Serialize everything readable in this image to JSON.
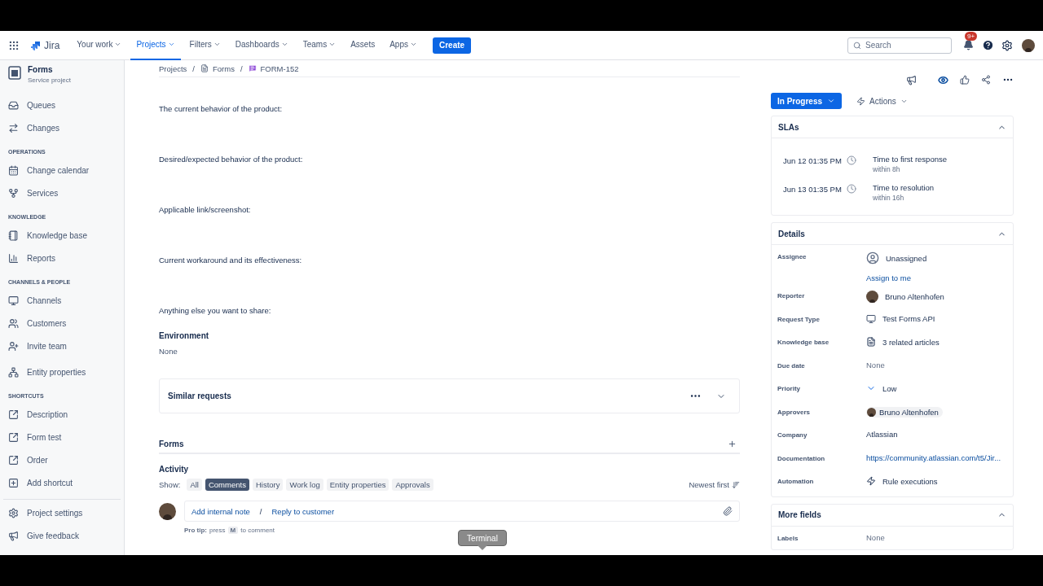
{
  "nav": {
    "product": "Jira",
    "items": [
      {
        "label": "Your work",
        "selected": false,
        "dropdown": true
      },
      {
        "label": "Projects",
        "selected": true,
        "dropdown": true
      },
      {
        "label": "Filters",
        "selected": false,
        "dropdown": true
      },
      {
        "label": "Dashboards",
        "selected": false,
        "dropdown": true
      },
      {
        "label": "Teams",
        "selected": false,
        "dropdown": true
      },
      {
        "label": "Assets",
        "selected": false,
        "dropdown": false
      },
      {
        "label": "Apps",
        "selected": false,
        "dropdown": true
      }
    ],
    "create": "Create",
    "search": {
      "placeholder": "Search"
    },
    "notifications": "9+"
  },
  "sidebar": {
    "project": {
      "name": "Forms",
      "type": "Service project"
    },
    "groups": [
      {
        "items": [
          "Queues",
          "Changes"
        ]
      },
      {
        "heading": "OPERATIONS",
        "items": [
          "Change calendar",
          "Services"
        ]
      },
      {
        "heading": "KNOWLEDGE",
        "items": [
          "Knowledge base",
          "Reports"
        ]
      },
      {
        "heading": "CHANNELS & PEOPLE",
        "items": [
          "Channels",
          "Customers",
          "Invite team"
        ]
      },
      {
        "items": [
          "Entity properties"
        ]
      },
      {
        "heading": "SHORTCUTS",
        "items": [
          "Description",
          "Form test",
          "Order",
          "Add shortcut"
        ]
      }
    ],
    "footer": [
      "Project settings",
      "Give feedback"
    ]
  },
  "breadcrumbs": [
    {
      "label": "Projects"
    },
    {
      "separator": "/",
      "label": "Forms"
    },
    {
      "separator": "/",
      "label": "FORM-152"
    }
  ],
  "description": [
    "The current behavior of the product:",
    "Desired/expected behavior of the product:",
    "Applicable link/screenshot:",
    "Current workaround and its effectiveness:",
    "Anything else you want to share:"
  ],
  "environment": {
    "label": "Environment",
    "value": "None"
  },
  "similar_requests": {
    "title": "Similar requests"
  },
  "forms": {
    "title": "Forms"
  },
  "activity": {
    "title": "Activity",
    "show_label": "Show:",
    "filters": [
      {
        "label": "All",
        "selected": false
      },
      {
        "label": "Comments",
        "selected": true
      },
      {
        "label": "History",
        "selected": false
      },
      {
        "label": "Work log",
        "selected": false
      },
      {
        "label": "Entity properties",
        "selected": false
      },
      {
        "label": "Approvals",
        "selected": false
      }
    ],
    "sort": "Newest first",
    "add_note": "Add internal note",
    "separator": "/",
    "reply": "Reply to customer",
    "pro_tip": {
      "label": "Pro tip:",
      "before": "press",
      "key": "M",
      "after": "to comment"
    }
  },
  "status": {
    "label": "In Progress"
  },
  "actions": "Actions",
  "slas": {
    "title": "SLAs",
    "expanded": true,
    "items": [
      {
        "date": "Jun 12 01:35 PM",
        "name": "Time to first response",
        "limit": "within 8h"
      },
      {
        "date": "Jun 13 01:35 PM",
        "name": "Time to resolution",
        "limit": "within 16h"
      }
    ]
  },
  "details": {
    "title": "Details",
    "expanded": true,
    "rows": [
      {
        "label": "Assignee",
        "kind": "unassigned",
        "value": "Unassigned",
        "action": "Assign to me"
      },
      {
        "label": "Reporter",
        "kind": "person",
        "value": "Bruno Altenhofen"
      },
      {
        "label": "Request Type",
        "kind": "request-type",
        "value": "Test Forms API"
      },
      {
        "label": "Knowledge base",
        "kind": "articles",
        "value": "3 related articles"
      },
      {
        "label": "Due date",
        "kind": "empty",
        "value": "None"
      },
      {
        "label": "Priority",
        "kind": "priority",
        "value": "Low"
      },
      {
        "label": "Approvers",
        "kind": "approver",
        "value": "Bruno Altenhofen"
      },
      {
        "label": "Company",
        "kind": "plain",
        "value": "Atlassian"
      },
      {
        "label": "Documentation",
        "kind": "link",
        "value": "https://community.atlassian.com/t5/Jir..."
      },
      {
        "label": "Automation",
        "kind": "automation",
        "value": "Rule executions"
      }
    ]
  },
  "more_fields": {
    "title": "More fields",
    "expanded": true,
    "rows": [
      {
        "label": "Labels",
        "kind": "empty",
        "value": "None"
      }
    ]
  },
  "tooltip": "Terminal"
}
